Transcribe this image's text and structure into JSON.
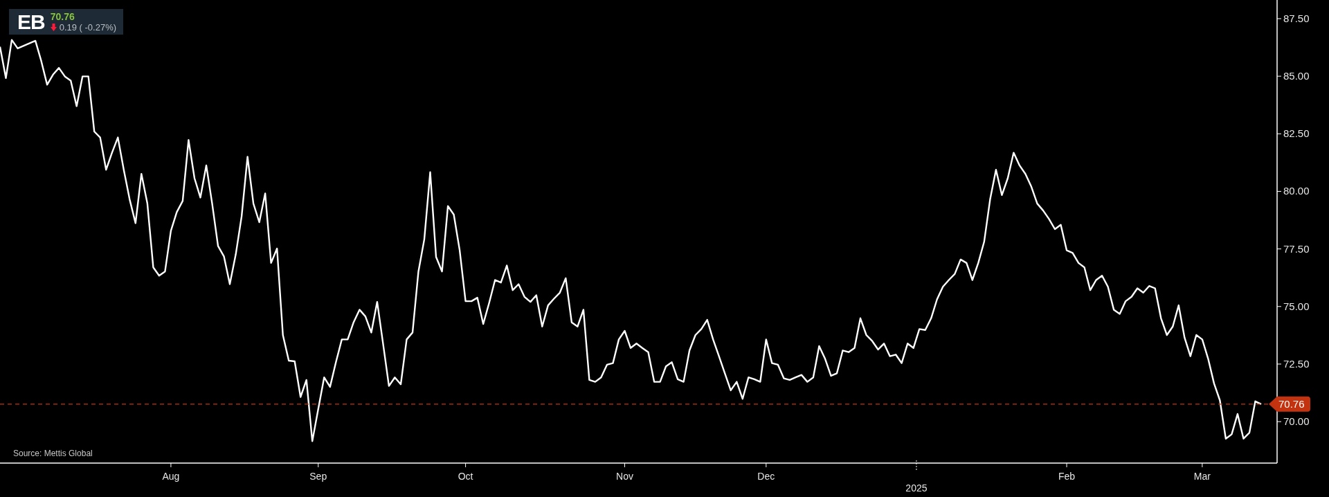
{
  "header": {
    "symbol": "EB",
    "price": "70.76",
    "change": "0.19 ( -0.27%)"
  },
  "chart": {
    "chart_data": {
      "type": "line",
      "ylim": [
        68.2,
        88.31
      ],
      "categories": [
        null,
        null,
        null,
        null,
        null,
        null,
        null,
        null,
        null,
        null,
        null,
        null,
        null,
        null,
        null,
        null,
        null,
        null,
        null,
        null,
        null,
        null,
        null,
        null,
        null,
        null,
        null,
        null,
        null,
        "Aug",
        null,
        null,
        null,
        null,
        null,
        null,
        null,
        null,
        null,
        null,
        null,
        null,
        null,
        null,
        null,
        null,
        null,
        null,
        null,
        null,
        null,
        null,
        null,
        null,
        "Sep",
        null,
        null,
        null,
        null,
        null,
        null,
        null,
        null,
        null,
        null,
        null,
        null,
        null,
        null,
        null,
        null,
        null,
        null,
        null,
        null,
        null,
        null,
        null,
        null,
        "Oct",
        null,
        null,
        null,
        null,
        null,
        null,
        null,
        null,
        null,
        null,
        null,
        null,
        null,
        null,
        null,
        null,
        null,
        null,
        null,
        null,
        null,
        null,
        null,
        null,
        null,
        null,
        "Nov",
        null,
        null,
        null,
        null,
        null,
        null,
        null,
        null,
        null,
        null,
        null,
        null,
        null,
        null,
        null,
        null,
        null,
        null,
        null,
        null,
        null,
        null,
        null,
        "Dec",
        null,
        null,
        null,
        null,
        null,
        null,
        null,
        null,
        null,
        null,
        null,
        null,
        null,
        null,
        null,
        null,
        null,
        null,
        null,
        null,
        null,
        null,
        null,
        null,
        null,
        null,
        null,
        null,
        null,
        null,
        null,
        null,
        null,
        null,
        null,
        null,
        null,
        null,
        null,
        null,
        null,
        null,
        null,
        null,
        null,
        null,
        null,
        null,
        null,
        null,
        "Feb",
        null,
        null,
        null,
        null,
        null,
        null,
        null,
        null,
        null,
        null,
        null,
        null,
        null,
        null,
        null,
        null,
        null,
        null,
        null,
        null,
        null,
        null,
        "Mar",
        null,
        null,
        null,
        null,
        null,
        null,
        null,
        null,
        null,
        null
      ],
      "xlabel": "2025",
      "yticks": [
        {
          "value": 70,
          "label": "70.00"
        },
        {
          "value": 72.5,
          "label": "72.50"
        },
        {
          "value": 75,
          "label": "75.00"
        },
        {
          "value": 77.5,
          "label": "77.50"
        },
        {
          "value": 80,
          "label": "80.00"
        },
        {
          "value": 82.5,
          "label": "82.50"
        },
        {
          "value": 85,
          "label": "85.00"
        },
        {
          "value": 87.5,
          "label": "87.50"
        }
      ],
      "series": [
        {
          "color": "#ffffff",
          "values": [
            86.28,
            84.92,
            86.58,
            86.21,
            null,
            null,
            86.54,
            85.66,
            84.63,
            85.07,
            85.36,
            84.99,
            84.81,
            83.7,
            84.99,
            84.99,
            82.6,
            82.34,
            80.94,
            81.68,
            82.34,
            80.94,
            79.65,
            78.62,
            80.76,
            79.47,
            76.7,
            76.34,
            76.52,
            78.29,
            79.1,
            79.58,
            82.23,
            80.57,
            79.73,
            81.13,
            79.47,
            77.63,
            77.18,
            75.97,
            77.26,
            78.92,
            81.5,
            79.47,
            78.66,
            79.91,
            76.89,
            77.52,
            73.76,
            72.65,
            72.62,
            71.07,
            71.81,
            69.15,
            70.55,
            71.92,
            71.51,
            72.58,
            73.57,
            73.57,
            74.31,
            74.86,
            74.57,
            73.87,
            75.2,
            73.39,
            71.55,
            71.92,
            71.62,
            73.57,
            73.87,
            76.52,
            77.92,
            80.83,
            77.15,
            76.52,
            79.36,
            78.99,
            77.44,
            75.23,
            75.23,
            75.38,
            74.24,
            75.16,
            76.15,
            76.04,
            76.78,
            75.71,
            75.97,
            75.42,
            75.2,
            75.49,
            74.13,
            75.05,
            75.34,
            75.6,
            76.23,
            74.31,
            74.13,
            74.86,
            71.81,
            71.73,
            71.92,
            72.47,
            72.54,
            73.57,
            73.94,
            73.2,
            73.39,
            73.2,
            73.02,
            71.73,
            71.73,
            72.4,
            72.58,
            71.84,
            71.73,
            73.09,
            73.76,
            74.02,
            74.42,
            73.57,
            72.84,
            72.1,
            71.36,
            71.73,
            70.99,
            71.92,
            71.84,
            71.73,
            73.57,
            72.54,
            72.47,
            71.88,
            71.81,
            71.92,
            72.03,
            71.73,
            71.92,
            73.28,
            72.73,
            71.99,
            72.1,
            73.09,
            73.02,
            73.2,
            74.49,
            73.76,
            73.5,
            73.13,
            73.39,
            72.84,
            72.91,
            72.54,
            73.39,
            73.2,
            74.02,
            73.98,
            74.49,
            75.31,
            75.86,
            76.15,
            76.41,
            77.04,
            76.89,
            76.15,
            76.89,
            77.81,
            79.65,
            80.94,
            79.84,
            80.57,
            81.68,
            81.13,
            80.76,
            80.2,
            79.47,
            79.17,
            78.8,
            78.36,
            78.55,
            77.44,
            77.33,
            76.89,
            76.7,
            75.71,
            76.15,
            76.34,
            75.86,
            74.86,
            74.68,
            75.23,
            75.42,
            75.79,
            75.6,
            75.89,
            75.79,
            74.49,
            73.76,
            74.13,
            75.05,
            73.65,
            72.84,
            73.76,
            73.57,
            72.73,
            71.66,
            70.92,
            69.26,
            69.45,
            70.33,
            69.26,
            69.52,
            70.88,
            70.76
          ]
        }
      ],
      "ref_lines": [
        {
          "axis": "y",
          "value": 70.76,
          "label": "70.76",
          "color": "#c4330f"
        }
      ]
    },
    "source": "Source: Mettis Global"
  }
}
